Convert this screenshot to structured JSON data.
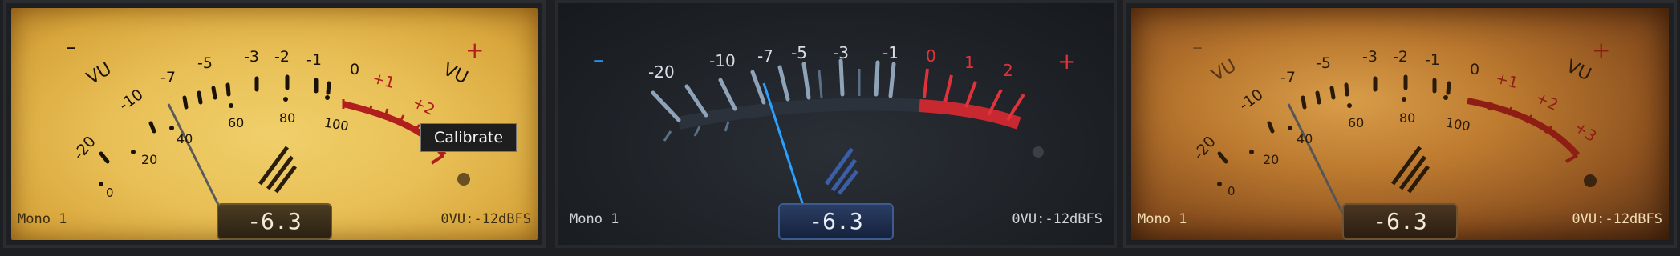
{
  "meters": [
    {
      "style": "classic-yellow",
      "channel": "Mono 1",
      "reference": "0VU:-12dBFS",
      "readout": "-6.3",
      "minus_label": "–",
      "plus_label": "+",
      "vu_left": "VU",
      "vu_right": "VU",
      "db_labels": [
        "-20",
        "-10",
        "-7",
        "-5",
        "-3",
        "-2",
        "-1",
        "0",
        "+1",
        "+2"
      ],
      "pct_labels": [
        "0",
        "20",
        "40",
        "60",
        "80",
        "100"
      ],
      "tooltip": "Calibrate",
      "colors": {
        "needle": "#5a5a5a",
        "red": "#b01e1e",
        "ink": "#1a1208"
      }
    },
    {
      "style": "modern-dark",
      "channel": "Mono 1",
      "reference": "0VU:-12dBFS",
      "readout": "-6.3",
      "minus_label": "–",
      "plus_label": "+",
      "db_labels": [
        "-20",
        "-10",
        "-7",
        "-5",
        "-3",
        "-1",
        "0",
        "1",
        "2"
      ],
      "colors": {
        "needle": "#2aa0ff",
        "red": "#e0323a",
        "ink": "#d8dde3"
      }
    },
    {
      "style": "vintage",
      "channel": "Mono 1",
      "reference": "0VU:-12dBFS",
      "readout": "-6.3",
      "minus_label": "–",
      "plus_label": "+",
      "vu_left": "VU",
      "vu_right": "VU",
      "db_labels": [
        "-20",
        "-10",
        "-7",
        "-5",
        "-3",
        "-2",
        "-1",
        "0",
        "+1",
        "+2",
        "+3"
      ],
      "pct_labels": [
        "0",
        "20",
        "40",
        "60",
        "80",
        "100"
      ],
      "colors": {
        "needle": "#555555",
        "red": "#8e1e14",
        "ink": "#2a1a08"
      }
    }
  ]
}
